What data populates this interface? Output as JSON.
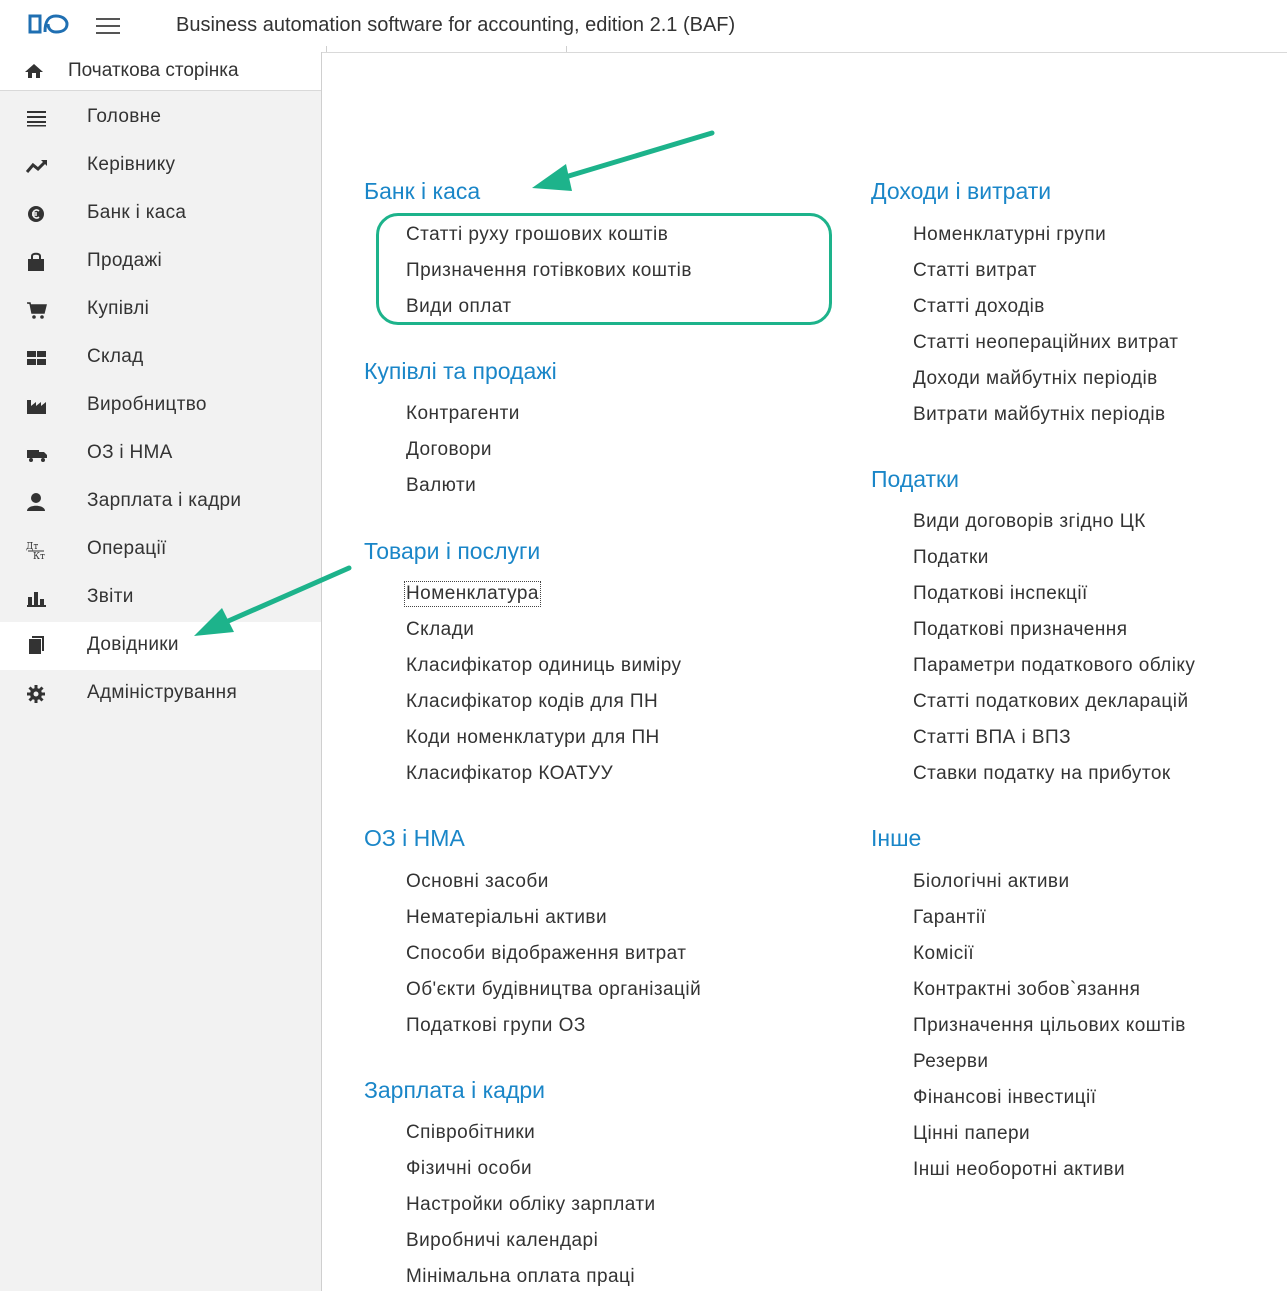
{
  "header": {
    "title": "Business automation software for accounting, edition 2.1  (BAF)",
    "logo_icon": "1c-logo-icon",
    "menu_icon": "hamburger-icon"
  },
  "sidebar": {
    "home": {
      "label": "Початкова сторінка",
      "icon": "home-icon"
    },
    "items": [
      {
        "label": "Головне",
        "icon": "menu-lines-icon"
      },
      {
        "label": "Керівнику",
        "icon": "trend-chart-icon"
      },
      {
        "label": "Банк і каса",
        "icon": "currency-coin-icon"
      },
      {
        "label": "Продажі",
        "icon": "shopping-bag-icon"
      },
      {
        "label": "Купівлі",
        "icon": "shopping-cart-icon"
      },
      {
        "label": "Склад",
        "icon": "warehouse-icon"
      },
      {
        "label": "Виробництво",
        "icon": "factory-icon"
      },
      {
        "label": "ОЗ і НМА",
        "icon": "truck-icon"
      },
      {
        "label": "Зарплата і кадри",
        "icon": "person-icon"
      },
      {
        "label": "Операції",
        "icon": "dt-kt-icon"
      },
      {
        "label": "Звіти",
        "icon": "bar-chart-icon"
      },
      {
        "label": "Довідники",
        "icon": "books-icon"
      },
      {
        "label": "Адміністрування",
        "icon": "gear-icon"
      }
    ],
    "active_item": "Довідники"
  },
  "sections": {
    "bank": {
      "title": "Банк і каса",
      "links": [
        "Статті руху грошових коштів",
        "Призначення готівкових коштів",
        "Види оплат"
      ]
    },
    "purchases_sales": {
      "title": "Купівлі та продажі",
      "links": [
        "Контрагенти",
        "Договори",
        "Валюти"
      ]
    },
    "goods": {
      "title": "Товари і послуги",
      "links": [
        "Номенклатура",
        "Склади",
        "Класифікатор одиниць виміру",
        "Класифікатор кодів для ПН",
        "Коди номенклатури для ПН",
        "Класифікатор КОАТУУ"
      ]
    },
    "fixed_assets": {
      "title": "ОЗ і НМА",
      "links": [
        "Основні засоби",
        "Нематеріальні активи",
        "Способи відображення витрат",
        "Об'єкти будівництва організацій",
        "Податкові групи ОЗ"
      ]
    },
    "salary": {
      "title": "Зарплата і кадри",
      "links": [
        "Співробітники",
        "Фізичні особи",
        "Настройки обліку зарплати",
        "Виробничі календарі",
        "Мінімальна оплата праці"
      ]
    },
    "income_expenses": {
      "title": "Доходи і витрати",
      "links": [
        "Номенклатурні групи",
        "Статті витрат",
        "Статті доходів",
        "Статті неопераційних витрат",
        "Доходи майбутніх періодів",
        "Витрати майбутніх періодів"
      ]
    },
    "taxes": {
      "title": "Податки",
      "links": [
        "Види договорів згідно ЦК",
        "Податки",
        "Податкові інспекції",
        "Податкові призначення",
        "Параметри податкового обліку",
        "Статті податкових декларацій",
        "Статті ВПА і ВПЗ",
        "Ставки податку на прибуток"
      ]
    },
    "other": {
      "title": "Інше",
      "links": [
        "Біологічні активи",
        "Гарантії",
        "Комісії",
        "Контрактні зобов`язання",
        "Призначення цільових коштів",
        "Резерви",
        "Фінансові інвестиції",
        "Цінні папери",
        "Інші необоротні активи"
      ]
    }
  },
  "colors": {
    "link_section": "#1a86c8",
    "annotation": "#1db38b",
    "sidebar_bg": "#f2f2f2"
  }
}
